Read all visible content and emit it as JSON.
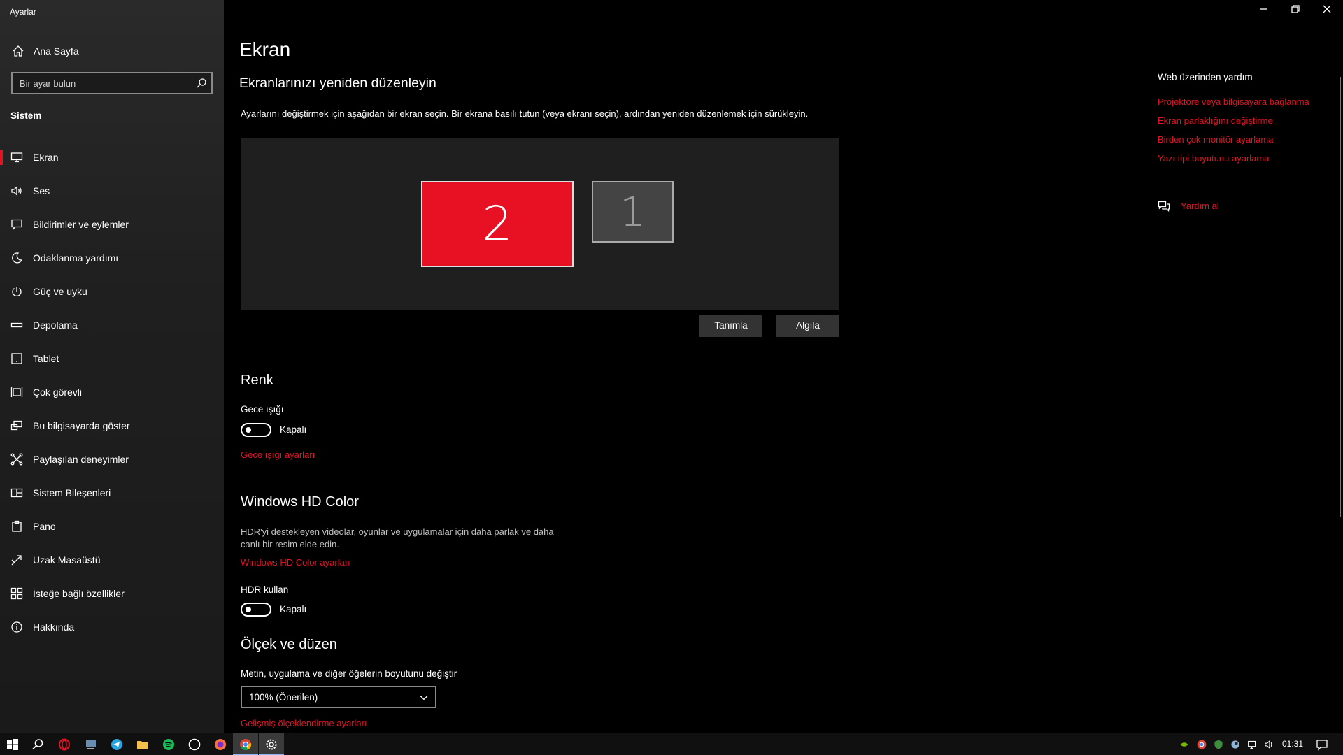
{
  "app": {
    "title": "Ayarlar"
  },
  "sidebar": {
    "home_label": "Ana Sayfa",
    "search_placeholder": "Bir ayar bulun",
    "section_label": "Sistem",
    "items": [
      {
        "label": "Ekran",
        "icon": "monitor-icon",
        "active": true
      },
      {
        "label": "Ses",
        "icon": "speaker-icon"
      },
      {
        "label": "Bildirimler ve eylemler",
        "icon": "notification-icon"
      },
      {
        "label": "Odaklanma yardımı",
        "icon": "moon-icon"
      },
      {
        "label": "Güç ve uyku",
        "icon": "power-icon"
      },
      {
        "label": "Depolama",
        "icon": "storage-icon"
      },
      {
        "label": "Tablet",
        "icon": "tablet-icon"
      },
      {
        "label": "Çok görevli",
        "icon": "multitasking-icon"
      },
      {
        "label": "Bu bilgisayarda göster",
        "icon": "project-icon"
      },
      {
        "label": "Paylaşılan deneyimler",
        "icon": "shared-icon"
      },
      {
        "label": "Sistem Bileşenleri",
        "icon": "components-icon"
      },
      {
        "label": "Pano",
        "icon": "clipboard-icon"
      },
      {
        "label": "Uzak Masaüstü",
        "icon": "remote-desktop-icon"
      },
      {
        "label": "İsteğe bağlı özellikler",
        "icon": "optional-features-icon"
      },
      {
        "label": "Hakkında",
        "icon": "info-icon"
      }
    ]
  },
  "main": {
    "title": "Ekran",
    "arrange": {
      "heading": "Ekranlarınızı yeniden düzenleyin",
      "description": "Ayarlarını değiştirmek için aşağıdan bir ekran seçin. Bir ekrana basılı tutun (veya ekranı seçin), ardından yeniden düzenlemek için sürükleyin.",
      "monitor_primary": "2",
      "monitor_secondary": "1",
      "identify_label": "Tanımla",
      "detect_label": "Algıla"
    },
    "color": {
      "heading": "Renk",
      "night_light_label": "Gece ışığı",
      "night_light_state": "Kapalı",
      "night_light_link": "Gece ışığı ayarları"
    },
    "hdr": {
      "heading": "Windows HD Color",
      "description": "HDR'yi destekleyen videolar, oyunlar ve uygulamalar için daha parlak ve daha canlı bir resim elde edin.",
      "link": "Windows HD Color ayarları",
      "use_hdr_label": "HDR kullan",
      "use_hdr_state": "Kapalı"
    },
    "scale": {
      "heading": "Ölçek ve düzen",
      "label": "Metin, uygulama ve diğer öğelerin boyutunu değiştir",
      "selected": "100% (Önerilen)",
      "link": "Gelişmiş ölçeklendirme ayarları"
    }
  },
  "help": {
    "title": "Web üzerinden yardım",
    "links": [
      "Projektöre veya bilgisayara bağlanma",
      "Ekran parlaklığını değiştirme",
      "Birden çok monitör ayarlama",
      "Yazı tipi boyutunu ayarlama"
    ],
    "get_help": "Yardım al"
  },
  "taskbar": {
    "time": "01:31"
  },
  "colors": {
    "accent": "#e81123",
    "sidebar_bg": "#1f1f1f",
    "canvas_bg": "#1f1f1f",
    "monitor_inactive": "#444444"
  }
}
